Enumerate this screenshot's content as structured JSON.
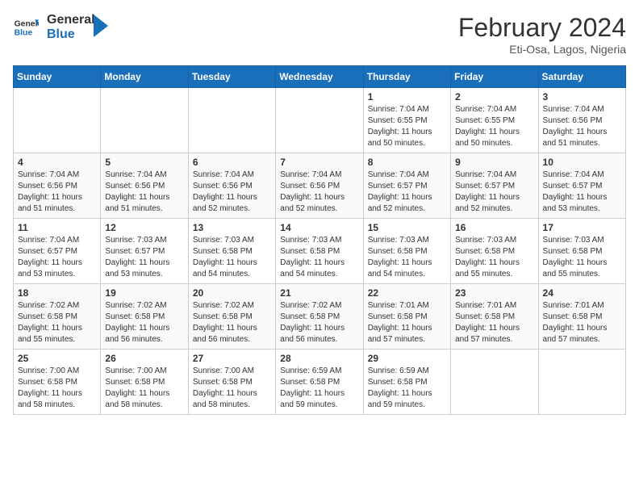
{
  "logo": {
    "line1": "General",
    "line2": "Blue"
  },
  "title": "February 2024",
  "subtitle": "Eti-Osa, Lagos, Nigeria",
  "weekdays": [
    "Sunday",
    "Monday",
    "Tuesday",
    "Wednesday",
    "Thursday",
    "Friday",
    "Saturday"
  ],
  "weeks": [
    [
      {
        "day": "",
        "info": ""
      },
      {
        "day": "",
        "info": ""
      },
      {
        "day": "",
        "info": ""
      },
      {
        "day": "",
        "info": ""
      },
      {
        "day": "1",
        "info": "Sunrise: 7:04 AM\nSunset: 6:55 PM\nDaylight: 11 hours and 50 minutes."
      },
      {
        "day": "2",
        "info": "Sunrise: 7:04 AM\nSunset: 6:55 PM\nDaylight: 11 hours and 50 minutes."
      },
      {
        "day": "3",
        "info": "Sunrise: 7:04 AM\nSunset: 6:56 PM\nDaylight: 11 hours and 51 minutes."
      }
    ],
    [
      {
        "day": "4",
        "info": "Sunrise: 7:04 AM\nSunset: 6:56 PM\nDaylight: 11 hours and 51 minutes."
      },
      {
        "day": "5",
        "info": "Sunrise: 7:04 AM\nSunset: 6:56 PM\nDaylight: 11 hours and 51 minutes."
      },
      {
        "day": "6",
        "info": "Sunrise: 7:04 AM\nSunset: 6:56 PM\nDaylight: 11 hours and 52 minutes."
      },
      {
        "day": "7",
        "info": "Sunrise: 7:04 AM\nSunset: 6:56 PM\nDaylight: 11 hours and 52 minutes."
      },
      {
        "day": "8",
        "info": "Sunrise: 7:04 AM\nSunset: 6:57 PM\nDaylight: 11 hours and 52 minutes."
      },
      {
        "day": "9",
        "info": "Sunrise: 7:04 AM\nSunset: 6:57 PM\nDaylight: 11 hours and 52 minutes."
      },
      {
        "day": "10",
        "info": "Sunrise: 7:04 AM\nSunset: 6:57 PM\nDaylight: 11 hours and 53 minutes."
      }
    ],
    [
      {
        "day": "11",
        "info": "Sunrise: 7:04 AM\nSunset: 6:57 PM\nDaylight: 11 hours and 53 minutes."
      },
      {
        "day": "12",
        "info": "Sunrise: 7:03 AM\nSunset: 6:57 PM\nDaylight: 11 hours and 53 minutes."
      },
      {
        "day": "13",
        "info": "Sunrise: 7:03 AM\nSunset: 6:58 PM\nDaylight: 11 hours and 54 minutes."
      },
      {
        "day": "14",
        "info": "Sunrise: 7:03 AM\nSunset: 6:58 PM\nDaylight: 11 hours and 54 minutes."
      },
      {
        "day": "15",
        "info": "Sunrise: 7:03 AM\nSunset: 6:58 PM\nDaylight: 11 hours and 54 minutes."
      },
      {
        "day": "16",
        "info": "Sunrise: 7:03 AM\nSunset: 6:58 PM\nDaylight: 11 hours and 55 minutes."
      },
      {
        "day": "17",
        "info": "Sunrise: 7:03 AM\nSunset: 6:58 PM\nDaylight: 11 hours and 55 minutes."
      }
    ],
    [
      {
        "day": "18",
        "info": "Sunrise: 7:02 AM\nSunset: 6:58 PM\nDaylight: 11 hours and 55 minutes."
      },
      {
        "day": "19",
        "info": "Sunrise: 7:02 AM\nSunset: 6:58 PM\nDaylight: 11 hours and 56 minutes."
      },
      {
        "day": "20",
        "info": "Sunrise: 7:02 AM\nSunset: 6:58 PM\nDaylight: 11 hours and 56 minutes."
      },
      {
        "day": "21",
        "info": "Sunrise: 7:02 AM\nSunset: 6:58 PM\nDaylight: 11 hours and 56 minutes."
      },
      {
        "day": "22",
        "info": "Sunrise: 7:01 AM\nSunset: 6:58 PM\nDaylight: 11 hours and 57 minutes."
      },
      {
        "day": "23",
        "info": "Sunrise: 7:01 AM\nSunset: 6:58 PM\nDaylight: 11 hours and 57 minutes."
      },
      {
        "day": "24",
        "info": "Sunrise: 7:01 AM\nSunset: 6:58 PM\nDaylight: 11 hours and 57 minutes."
      }
    ],
    [
      {
        "day": "25",
        "info": "Sunrise: 7:00 AM\nSunset: 6:58 PM\nDaylight: 11 hours and 58 minutes."
      },
      {
        "day": "26",
        "info": "Sunrise: 7:00 AM\nSunset: 6:58 PM\nDaylight: 11 hours and 58 minutes."
      },
      {
        "day": "27",
        "info": "Sunrise: 7:00 AM\nSunset: 6:58 PM\nDaylight: 11 hours and 58 minutes."
      },
      {
        "day": "28",
        "info": "Sunrise: 6:59 AM\nSunset: 6:58 PM\nDaylight: 11 hours and 59 minutes."
      },
      {
        "day": "29",
        "info": "Sunrise: 6:59 AM\nSunset: 6:58 PM\nDaylight: 11 hours and 59 minutes."
      },
      {
        "day": "",
        "info": ""
      },
      {
        "day": "",
        "info": ""
      }
    ]
  ]
}
